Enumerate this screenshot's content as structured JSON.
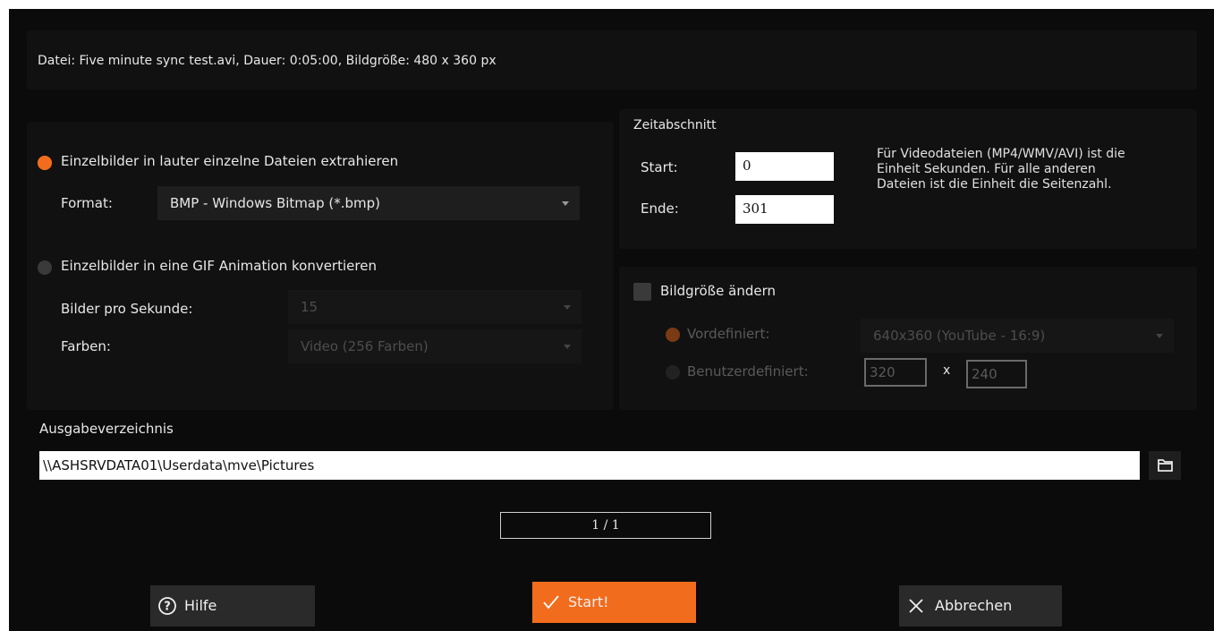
{
  "file_info": "Datei: Five minute sync test.avi, Dauer: 0:05:00, Bildgröße: 480 x 360 px",
  "extract": {
    "option_files_label": "Einzelbilder in lauter einzelne Dateien extrahieren",
    "format_label": "Format:",
    "format_value": "BMP - Windows Bitmap (*.bmp)",
    "option_gif_label": "Einzelbilder in eine GIF Animation konvertieren",
    "fps_label": "Bilder pro Sekunde:",
    "fps_value": "15",
    "colors_label": "Farben:",
    "colors_value": "Video (256 Farben)"
  },
  "time_range": {
    "title": "Zeitabschnitt",
    "start_label": "Start:",
    "start_value": "0",
    "end_label": "Ende:",
    "end_value": "301",
    "note": [
      "Für Videodateien (MP4/WMV/AVI) ist die",
      "Einheit Sekunden. Für alle anderen",
      "Dateien ist die Einheit die Seitenzahl."
    ]
  },
  "resize": {
    "checkbox_label": "Bildgröße ändern",
    "predefined_label": "Vordefiniert:",
    "predefined_value": "640x360 (YouTube - 16:9)",
    "custom_label": "Benutzerdefiniert:",
    "width_value": "320",
    "x_sep": "x",
    "height_value": "240"
  },
  "output": {
    "label": "Ausgabeverzeichnis",
    "path": "\\\\ASHSRVDATA01\\Userdata\\mve\\Pictures",
    "browse_icon": "folder-icon"
  },
  "progress": {
    "text": "1 / 1",
    "fraction": 1.0
  },
  "buttons": {
    "help": "Hilfe",
    "start": "Start!",
    "cancel": "Abbrechen"
  },
  "colors": {
    "accent": "#f26c1d",
    "background": "#0b0b0b"
  }
}
